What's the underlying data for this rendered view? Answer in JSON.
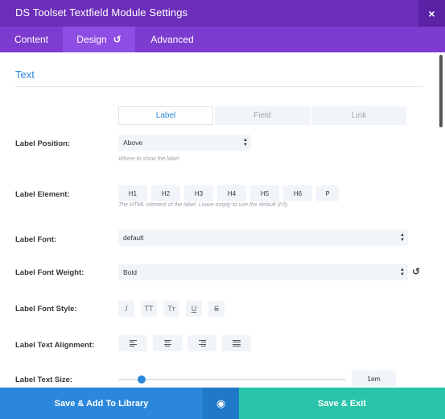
{
  "header": {
    "title": "DS Toolset Textfield Module Settings",
    "close_label": "×"
  },
  "tabs": [
    {
      "label": "Content"
    },
    {
      "label": "Design",
      "reset_glyph": "↺"
    },
    {
      "label": "Advanced"
    }
  ],
  "section": {
    "title": "Text"
  },
  "subtabs": [
    {
      "label": "Label"
    },
    {
      "label": "Field"
    },
    {
      "label": "Link"
    }
  ],
  "label_position": {
    "label": "Label Position:",
    "value": "Above",
    "description": "Where to show the label."
  },
  "label_element": {
    "label": "Label Element:",
    "options": [
      "H1",
      "H2",
      "H3",
      "H4",
      "H5",
      "H6",
      "P"
    ],
    "description": "The HTML element of the label. Leave empty to use the default (h3)."
  },
  "label_font": {
    "label": "Label Font:",
    "value": "default"
  },
  "label_font_weight": {
    "label": "Label Font Weight:",
    "value": "Bold",
    "reset_glyph": "↺"
  },
  "label_font_style": {
    "label": "Label Font Style:",
    "buttons": [
      "I",
      "TT",
      "Tт",
      "U",
      "S"
    ]
  },
  "label_text_alignment": {
    "label": "Label Text Alignment:"
  },
  "label_text_size": {
    "label": "Label Text Size:",
    "value": "1em"
  },
  "footer": {
    "library_label": "Save & Add To Library",
    "preview_glyph": "◉",
    "save_label": "Save & Exit"
  },
  "colors": {
    "header": "#6c2eb9",
    "tabs": "#7e3bd0",
    "accent": "#2b87da",
    "save": "#29c4a9"
  }
}
